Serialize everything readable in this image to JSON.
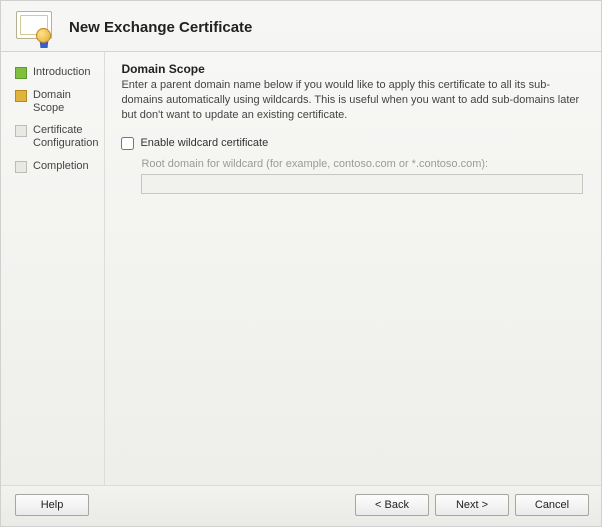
{
  "header": {
    "title": "New Exchange Certificate"
  },
  "sidebar": {
    "steps": [
      {
        "label": "Introduction",
        "state": "done"
      },
      {
        "label": "Domain Scope",
        "state": "current"
      },
      {
        "label": "Certificate Configuration",
        "state": "pending"
      },
      {
        "label": "Completion",
        "state": "pending"
      }
    ]
  },
  "content": {
    "section_title": "Domain Scope",
    "description": "Enter a parent domain name below if you would like to apply this certificate to all its sub-domains automatically using wildcards. This is useful when you want to add sub-domains later but don't want to update an existing certificate.",
    "enable_wildcard_label": "Enable wildcard certificate",
    "enable_wildcard_checked": false,
    "root_domain_label": "Root domain for wildcard (for example, contoso.com or *.contoso.com):",
    "root_domain_value": ""
  },
  "footer": {
    "help": "Help",
    "back": "< Back",
    "next": "Next >",
    "cancel": "Cancel"
  }
}
